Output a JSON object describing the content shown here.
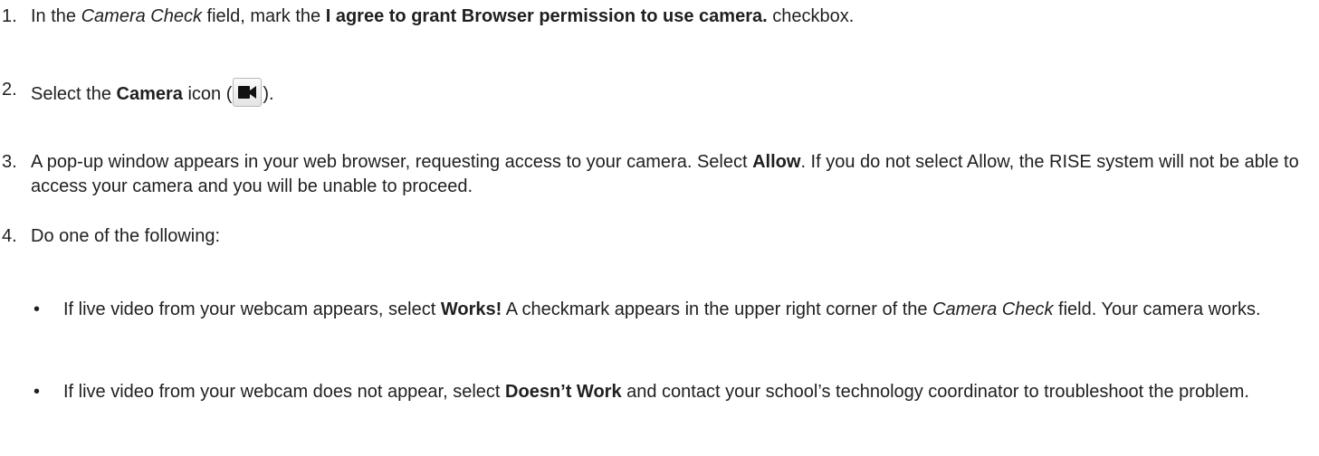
{
  "steps": [
    {
      "number": "1.",
      "t1": "In the ",
      "t2": "Camera Check",
      "t3": " field, mark the ",
      "t4": "I agree to grant Browser permission to use camera.",
      "t5": " checkbox."
    },
    {
      "number": "2.",
      "t1": "Select the ",
      "t2": "Camera",
      "t3": " icon (",
      "icon": "video-camera-icon",
      "t4": ")."
    },
    {
      "number": "3.",
      "t1": "A pop-up window appears in your web browser, requesting access to your camera. Select ",
      "t2": "Allow",
      "t3": ". If you do not select Allow, the RISE system will not be able to access your camera and you will be unable to proceed."
    },
    {
      "number": "4.",
      "t1": "Do one of the following:"
    }
  ],
  "bullets": [
    {
      "symbol": "•",
      "t1": "If live video from your webcam appears, select ",
      "t2": "Works!",
      "t3": " A checkmark appears in the upper right corner of the ",
      "t4": "Camera Check",
      "t5": " field. Your camera works."
    },
    {
      "symbol": "•",
      "t1": "If live video from your webcam does not appear, select ",
      "t2": "Doesn’t Work",
      "t3": " and contact your school’s technology coordinator to troubleshoot the problem."
    }
  ]
}
